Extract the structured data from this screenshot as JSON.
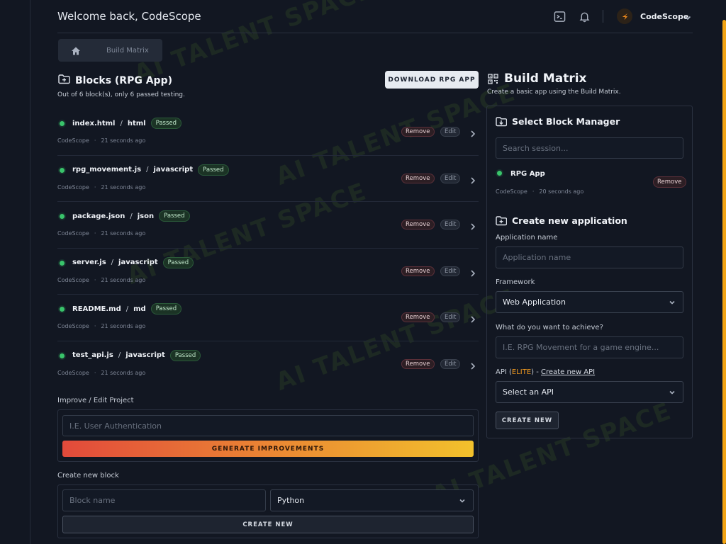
{
  "header": {
    "welcome": "Welcome back, CodeScope",
    "user_name": "CodeScope",
    "icons": [
      "terminal-icon",
      "bell-icon",
      "avatar-logo-icon",
      "chevron-down-icon"
    ]
  },
  "breadcrumb": {
    "home_icon": "home-icon",
    "current": "Build Matrix"
  },
  "blocks": {
    "title": "Blocks (RPG App)",
    "subtitle": "Out of 6 block(s), only 6 passed testing.",
    "download_label": "DOWNLOAD RPG APP",
    "remove_label": "Remove",
    "edit_label": "Edit",
    "items": [
      {
        "name": "index.html",
        "lang": "html",
        "status": "Passed",
        "author": "CodeScope",
        "time": "21 seconds ago"
      },
      {
        "name": "rpg_movement.js",
        "lang": "javascript",
        "status": "Passed",
        "author": "CodeScope",
        "time": "21 seconds ago"
      },
      {
        "name": "package.json",
        "lang": "json",
        "status": "Passed",
        "author": "CodeScope",
        "time": "21 seconds ago"
      },
      {
        "name": "server.js",
        "lang": "javascript",
        "status": "Passed",
        "author": "CodeScope",
        "time": "21 seconds ago"
      },
      {
        "name": "README.md",
        "lang": "md",
        "status": "Passed",
        "author": "CodeScope",
        "time": "21 seconds ago"
      },
      {
        "name": "test_api.js",
        "lang": "javascript",
        "status": "Passed",
        "author": "CodeScope",
        "time": "21 seconds ago"
      }
    ]
  },
  "improve": {
    "label": "Improve / Edit Project",
    "placeholder": "I.E. User Authentication",
    "button": "GENERATE IMPROVEMENTS"
  },
  "new_block": {
    "label": "Create new block",
    "name_placeholder": "Block name",
    "language_selected": "Python",
    "button": "CREATE NEW"
  },
  "build_matrix": {
    "title": "Build Matrix",
    "subtitle": "Create a basic app using the Build Matrix.",
    "select_manager": {
      "title": "Select Block Manager",
      "search_placeholder": "Search session...",
      "session": {
        "name": "RPG App",
        "author": "CodeScope",
        "time": "20 seconds ago",
        "remove_label": "Remove"
      }
    },
    "create_app": {
      "title": "Create new application",
      "name_label": "Application name",
      "name_placeholder": "Application name",
      "framework_label": "Framework",
      "framework_selected": "Web Application",
      "goal_label": "What do you want to achieve?",
      "goal_placeholder": "I.E. RPG Movement for a game engine...",
      "api_label_prefix": "API (",
      "api_elite": "ELITE",
      "api_label_suffix": ") - ",
      "api_link": "Create new API",
      "api_selected": "Select an API",
      "button": "CREATE NEW"
    }
  },
  "watermark": "AI TALENT SPACE",
  "colors": {
    "background": "#121722",
    "accent": "#f2a313",
    "success": "#39c46b",
    "danger": "#5b3039"
  }
}
